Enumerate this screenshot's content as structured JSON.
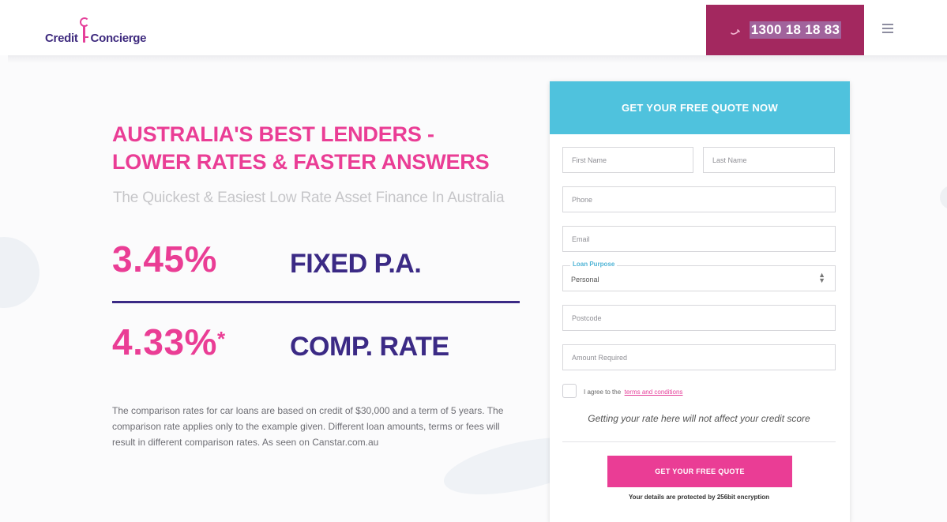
{
  "header": {
    "logo": {
      "part1": "Credit",
      "part2": "Concierge"
    },
    "phone": {
      "number": "1300 18 18 83",
      "icon": "phone-icon"
    },
    "menu": {
      "icon": "hamburger-menu-icon"
    }
  },
  "hero": {
    "title_line1": "AUSTRALIA'S BEST LENDERS -",
    "title_line2": "LOWER RATES & FASTER ANSWERS",
    "subtitle": "The Quickest & Easiest Low Rate Asset Finance In Australia",
    "fixed_rate": "3.45%",
    "fixed_label": "FIXED P.A.",
    "comp_rate": "4.33%",
    "comp_asterisk": "*",
    "comp_label": "COMP. RATE",
    "disclaimer": "The comparison rates for car loans are based on credit of $30,000 and a term of 5 years. The comparison rate applies only to the example given. Different loan amounts, terms or fees will result in different comparison rates. As seen on Canstar.com.au"
  },
  "form": {
    "heading": "GET YOUR FREE QUOTE NOW",
    "first_name_placeholder": "First Name",
    "last_name_placeholder": "Last Name",
    "phone_placeholder": "Phone",
    "email_placeholder": "Email",
    "loan_purpose_label": "Loan Purpose",
    "loan_purpose_value": "Personal",
    "postcode_placeholder": "Postcode",
    "amount_placeholder": "Amount Required",
    "agree_prefix": "I agree to the",
    "agree_link": "terms and conditions",
    "credit_note": "Getting your rate here will not affect your credit score",
    "submit_label": "GET YOUR FREE QUOTE",
    "secure_note": "Your details are protected by 256bit encryption"
  },
  "colors": {
    "brand_pink": "#ea3d95",
    "brand_purple": "#3b2a85",
    "phone_bg": "#a3285f",
    "form_header": "#4fc2dd"
  }
}
